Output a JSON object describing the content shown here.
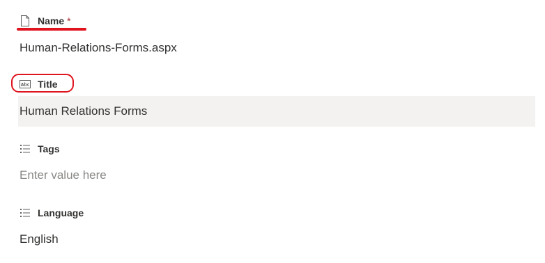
{
  "fields": {
    "name": {
      "label": "Name",
      "required_mark": "*",
      "value": "Human-Relations-Forms.aspx",
      "icon": "document-icon"
    },
    "title": {
      "label": "Title",
      "value": "Human Relations Forms",
      "icon": "text-abc-icon"
    },
    "tags": {
      "label": "Tags",
      "placeholder": "Enter value here",
      "icon": "list-icon"
    },
    "language": {
      "label": "Language",
      "value": "English",
      "icon": "list-icon"
    }
  },
  "annotations": {
    "highlight_color": "#e0141e"
  }
}
